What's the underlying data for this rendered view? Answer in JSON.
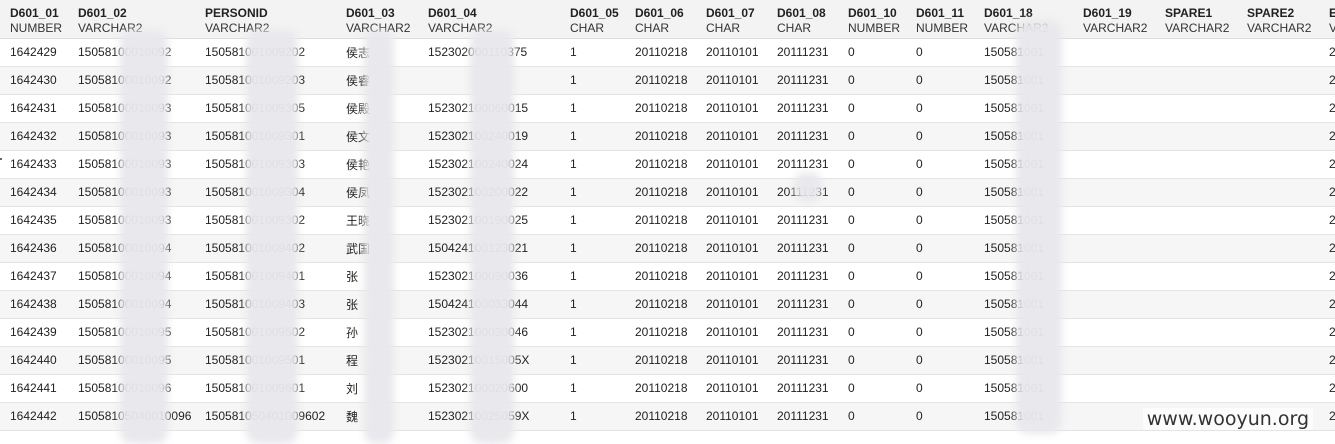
{
  "columns": [
    {
      "name": "D601_01",
      "type": "NUMBER"
    },
    {
      "name": "D601_02",
      "type": "VARCHAR2"
    },
    {
      "name": "PERSONID",
      "type": "VARCHAR2"
    },
    {
      "name": "D601_03",
      "type": "VARCHAR2"
    },
    {
      "name": "D601_04",
      "type": "VARCHAR2"
    },
    {
      "name": "D601_05",
      "type": "CHAR"
    },
    {
      "name": "D601_06",
      "type": "CHAR"
    },
    {
      "name": "D601_07",
      "type": "CHAR"
    },
    {
      "name": "D601_08",
      "type": "CHAR"
    },
    {
      "name": "D601_10",
      "type": "NUMBER"
    },
    {
      "name": "D601_11",
      "type": "NUMBER"
    },
    {
      "name": "D601_18",
      "type": "VARCHAR2"
    },
    {
      "name": "D601_19",
      "type": "VARCHAR2"
    },
    {
      "name": "SPARE1",
      "type": "VARCHAR2"
    },
    {
      "name": "SPARE2",
      "type": "VARCHAR2"
    },
    {
      "name": "E",
      "type": "V"
    }
  ],
  "rows": [
    [
      "1642429",
      "15058100010092",
      "150581001009202",
      "侯志",
      "152302000110375",
      "1",
      "20110218",
      "20110101",
      "20111231",
      "0",
      "0",
      "150581001",
      "",
      "",
      "",
      "2"
    ],
    [
      "1642430",
      "15058100010092",
      "150581001009203",
      "侯睿",
      "",
      "1",
      "20110218",
      "20110101",
      "20111231",
      "0",
      "0",
      "150581001",
      "",
      "",
      "",
      "2"
    ],
    [
      "1642431",
      "15058100010093",
      "150581001009305",
      "侯殿",
      "152302100060015",
      "1",
      "20110218",
      "20110101",
      "20111231",
      "0",
      "0",
      "150581001",
      "",
      "",
      "",
      "2"
    ],
    [
      "1642432",
      "15058100010093",
      "150581001009301",
      "侯文",
      "152302100240019",
      "1",
      "20110218",
      "20110101",
      "20111231",
      "0",
      "0",
      "150581001",
      "",
      "",
      "",
      "2"
    ],
    [
      "1642433",
      "15058100010093",
      "150581001009303",
      "侯艳",
      "152302100240024",
      "1",
      "20110218",
      "20110101",
      "20111231",
      "0",
      "0",
      "150581001",
      "",
      "",
      "",
      "2"
    ],
    [
      "1642434",
      "15058100010093",
      "150581001009304",
      "侯凤",
      "152302100200022",
      "1",
      "20110218",
      "20110101",
      "20111231",
      "0",
      "0",
      "150581001",
      "",
      "",
      "",
      "2"
    ],
    [
      "1642435",
      "15058100010093",
      "150581001009302",
      "王晓",
      "152302100190025",
      "1",
      "20110218",
      "20110101",
      "20111231",
      "0",
      "0",
      "150581001",
      "",
      "",
      "",
      "2"
    ],
    [
      "1642436",
      "15058100010094",
      "150581001009402",
      "武国",
      "150424100123021",
      "1",
      "20110218",
      "20110101",
      "20111231",
      "0",
      "0",
      "150581001",
      "",
      "",
      "",
      "2"
    ],
    [
      "1642437",
      "15058100010094",
      "150581001009401",
      "张",
      "152302100090036",
      "1",
      "20110218",
      "20110101",
      "20111231",
      "0",
      "0",
      "150581001",
      "",
      "",
      "",
      "2"
    ],
    [
      "1642438",
      "15058100010094",
      "150581001009403",
      "张",
      "150424100033044",
      "1",
      "20110218",
      "20110101",
      "20111231",
      "0",
      "0",
      "150581001",
      "",
      "",
      "",
      "2"
    ],
    [
      "1642439",
      "15058100010095",
      "150581001009502",
      "孙",
      "152302100030046",
      "1",
      "20110218",
      "20110101",
      "20111231",
      "0",
      "0",
      "150581001",
      "",
      "",
      "",
      "2"
    ],
    [
      "1642440",
      "15058100010095",
      "150581001009501",
      "程",
      "15230210015005X",
      "1",
      "20110218",
      "20110101",
      "20111231",
      "0",
      "0",
      "150581001",
      "",
      "",
      "",
      "2"
    ],
    [
      "1642441",
      "15058100010096",
      "150581001009601",
      "刘",
      "152302100020600",
      "1",
      "20110218",
      "20110101",
      "20111231",
      "0",
      "0",
      "150581001",
      "",
      "",
      "",
      "2"
    ],
    [
      "1642442",
      "15058105040010096",
      "150581050401009602",
      "魏",
      "15230210025059X",
      "1",
      "20110218",
      "20110101",
      "20111231",
      "0",
      "0",
      "150581001",
      "",
      "",
      "",
      "2"
    ]
  ],
  "watermark": "www.wooyun.org"
}
